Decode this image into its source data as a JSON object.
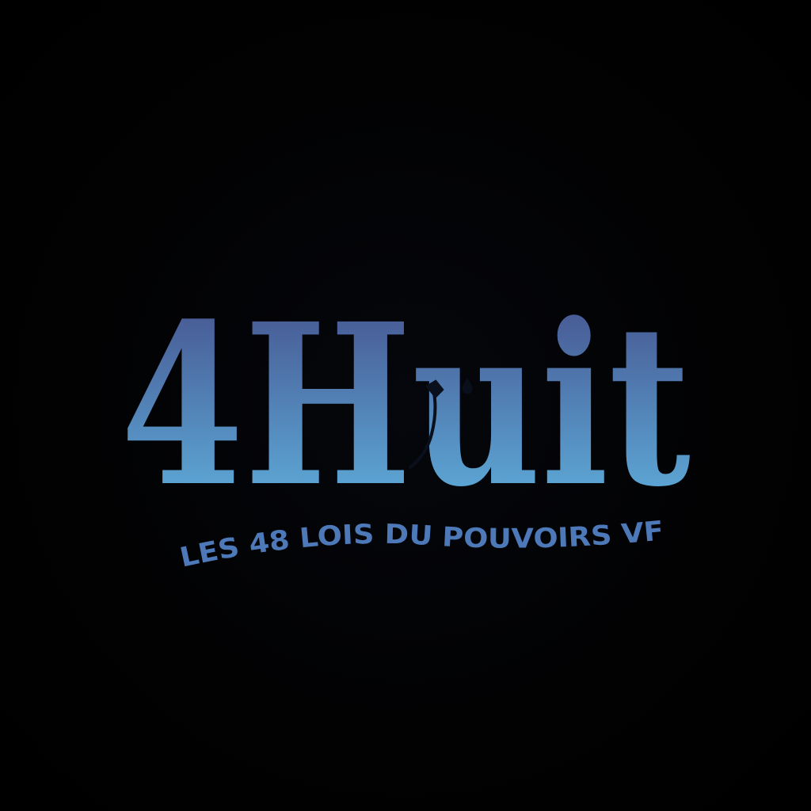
{
  "logo": {
    "wordmark": "4HUIT",
    "tagline": "LES 48 LOIS DU POUVOIRS VF"
  },
  "colors": {
    "background": "#000000",
    "gradient_top": "#45508c",
    "gradient_bottom": "#5ba3d2",
    "tagline": "#4d79b8"
  }
}
